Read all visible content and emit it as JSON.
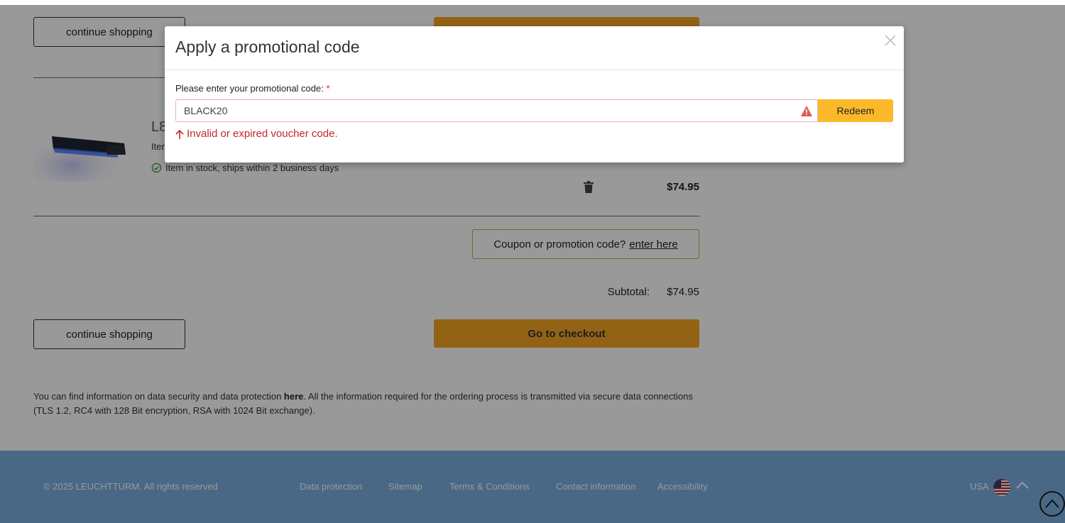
{
  "cart": {
    "continue_shopping_label": "continue shopping",
    "checkout_label": "Go to checkout",
    "product": {
      "title": "L8",
      "subtitle": "Iten",
      "stock_text": "Item in stock, ships within 2 business days",
      "price": "$74.95"
    },
    "coupon_prompt": "Coupon or promotion code?",
    "coupon_link": "enter here",
    "subtotal_label": "Subtotal:",
    "subtotal_value": "$74.95",
    "info_prefix": "You can find information on data security and data protection ",
    "info_link": "here",
    "info_suffix": ". All the information required for the ordering process is transmitted via secure data connections (TLS 1.2, RC4 with 128 Bit encryption, RSA with 1024 Bit exchange)."
  },
  "footer": {
    "copyright": "© 2025 LEUCHTTURM. All rights reserved",
    "links": [
      "Data protection",
      "Sitemap",
      "Terms & Conditions",
      "Contact information",
      "Accessibility"
    ],
    "country": "USA"
  },
  "modal": {
    "title": "Apply a promotional code",
    "field_label": "Please enter your promotional code:",
    "required_mark": "*",
    "input_value": "BLACK20",
    "redeem_label": "Redeem",
    "error_text": "Invalid or expired voucher code."
  },
  "colors": {
    "checkout_button": "#f5a623",
    "redeem_button": "#fbb92a",
    "error": "#c0262d",
    "footer_bg": "#78aee0",
    "coupon_border": "#a8b84b"
  },
  "icons": [
    "check-circle-icon",
    "trash-icon",
    "close-icon",
    "warning-icon",
    "arrow-up-icon",
    "us-flag-icon",
    "chevron-up-icon",
    "scroll-top-icon"
  ]
}
